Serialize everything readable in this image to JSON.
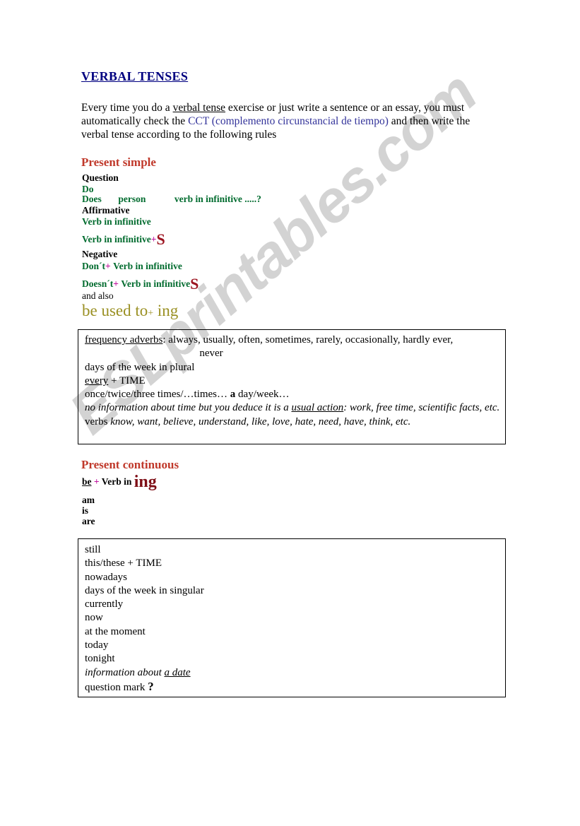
{
  "document": {
    "title": "VERBAL TENSES",
    "intro": {
      "part1": "Every time you do a ",
      "underlined1": "verbal tense",
      "part2": " exercise or just write a sentence or an essay, you must automatically check the ",
      "blue": "CCT (complemento circunstancial de tiempo)",
      "part3": " and then write the verbal tense according to the following rules"
    },
    "watermark": "ESLprintables.com"
  },
  "present_simple": {
    "heading": "Present simple",
    "question_label": "Question",
    "do": "Do",
    "does_line": "Does       person            verb in infinitive .....?",
    "affirmative_label": "Affirmative",
    "verb_infinitive": "Verb in infinitive",
    "verb_infinitive_s_base": "Verb in infinitive",
    "plus": "+",
    "s_marker": "S",
    "negative_label": "Negative",
    "dont_line": "Don´t",
    "dont_rest": "Verb in infinitive",
    "doesnt_line": "Doesn´t",
    "doesnt_rest": "Verb in infinitive",
    "and_also": "and also",
    "be_used_to": "be used to",
    "be_used_to_ing": "ing",
    "box": {
      "line1_label": "frequency adverbs",
      "line1_rest": ": always, usually, often, sometimes, rarely, occasionally, hardly ever,",
      "line1_center": "never",
      "line2": "days of the week in plural",
      "line3_label": "every",
      "line3_rest": " + TIME",
      "line4_a": "once/twice/three times/…times… ",
      "line4_bold": "a",
      "line4_b": " day/week…",
      "line5_a": "no information about time but you deduce it is a ",
      "line5_u": "usual action",
      "line5_b": ": work, free time, scientific facts, etc.",
      "line6_a": "verbs ",
      "line6_it": "know, want, believe, understand, like, love, hate, need, have, think, etc."
    }
  },
  "present_continuous": {
    "heading": "Present continuous",
    "formula_be": "be",
    "formula_plus": "+",
    "formula_verb": "Verb in",
    "formula_ing": "ing",
    "aux": [
      "am",
      "is",
      "are"
    ],
    "box": {
      "items": [
        "still",
        "this/these + TIME",
        "nowadays",
        "days of the week in singular",
        "currently",
        "now",
        "at the moment",
        "today",
        "tonight"
      ],
      "italic_item_a": "information about ",
      "italic_item_u": "a date",
      "last_item": "question mark ",
      "last_item_mark": "?"
    }
  },
  "colors": {
    "title": "#000080",
    "heading": "#c0392b",
    "green": "#006b2e",
    "plus": "#c0159f",
    "dark_red": "#9c1420",
    "olive": "#9a9023",
    "blue_text": "#33339a"
  }
}
